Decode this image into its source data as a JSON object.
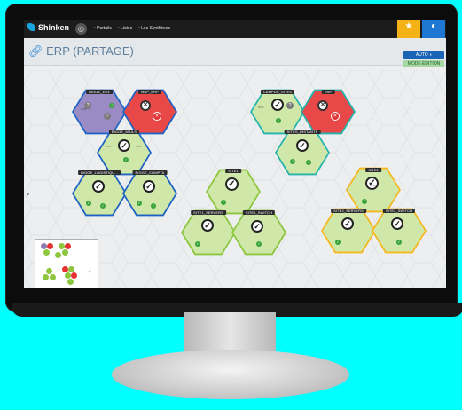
{
  "app": {
    "brand": "Shinken",
    "title": "ERP (PARTAGE)"
  },
  "nav": {
    "items": [
      "Portails",
      "Listes",
      "Les Synthèses"
    ]
  },
  "toolbar": {
    "auto_label": "AUTO",
    "mode_label": "MODE ÉDITION"
  },
  "colors": {
    "ok": "#8ec63f",
    "critical": "#e63232",
    "unknown": "#8e7bb3",
    "topbar": "#1c1c1c",
    "accent_blue": "#1a63b5",
    "favorite": "#f5b216"
  },
  "nodes": [
    {
      "label": "BIGGE_ESX",
      "status": "unknown"
    },
    {
      "label": "MSP_ERP",
      "status": "critical"
    },
    {
      "label": "BIGGE_MAILS",
      "status": "ok"
    },
    {
      "label": "BIGGE_LOGISTIQU...",
      "status": "ok"
    },
    {
      "label": "BIGGE_COMPTA",
      "status": "ok"
    },
    {
      "label": "CAMPUS_SITES",
      "status": "ok"
    },
    {
      "label": "ERP",
      "status": "critical"
    },
    {
      "label": "SITES_DISTANTS",
      "status": "ok"
    },
    {
      "label": "SITE1",
      "status": "ok"
    },
    {
      "label": "SITE1_SERVERS",
      "status": "ok"
    },
    {
      "label": "SITE1_SWITCH",
      "status": "ok"
    },
    {
      "label": "SITE2",
      "status": "ok"
    },
    {
      "label": "SITE2_SERVERS",
      "status": "ok"
    },
    {
      "label": "SITE2_SWITCH",
      "status": "ok"
    }
  ],
  "icons": {
    "check": "check-circle-icon",
    "critical": "x-circle-icon",
    "unknown": "question-icon"
  }
}
